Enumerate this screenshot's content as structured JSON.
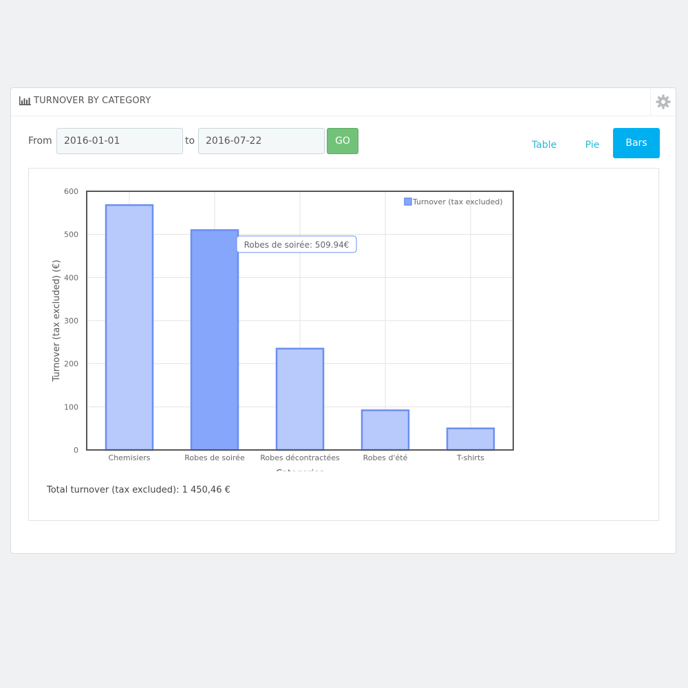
{
  "panel": {
    "title": "TURNOVER BY CATEGORY",
    "title_icon": "bar-chart-icon",
    "settings_icon": "gear-icon"
  },
  "filters": {
    "from_label": "From",
    "from_value": "2016-01-01",
    "to_label": "to",
    "to_value": "2016-07-22",
    "go_label": "GO"
  },
  "views": {
    "table_label": "Table",
    "pie_label": "Pie",
    "bars_label": "Bars",
    "active": "Bars"
  },
  "colors": {
    "bar_fill": "#b8c9fb",
    "bar_stroke": "#6b8ef0",
    "bar_fill_highlight": "#86a6fb",
    "go_green": "#72c279",
    "active_blue": "#00aff0",
    "link_blue": "#25b9d7"
  },
  "chart_data": {
    "type": "bar",
    "categories": [
      "Chemisiers",
      "Robes de soirée",
      "Robes décontractées",
      "Robes d'été",
      "T-shirts"
    ],
    "series": [
      {
        "name": "Turnover (tax excluded)",
        "values": [
          568,
          509.94,
          235,
          92,
          50
        ]
      }
    ],
    "xlabel": "Categories",
    "ylabel": "Turnover (tax excluded) (€)",
    "ylim": [
      0,
      600
    ],
    "yticks": [
      0,
      100,
      200,
      300,
      400,
      500,
      600
    ],
    "grid": true,
    "legend": "top-right",
    "highlighted_index": 1,
    "tooltip": "Robes de soirée: 509.94€"
  },
  "total_text": "Total turnover (tax excluded): 1 450,46 €"
}
